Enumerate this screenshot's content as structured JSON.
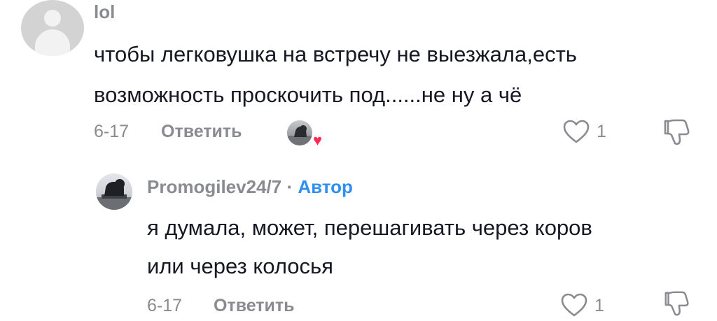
{
  "comments": [
    {
      "username": "lol",
      "text_lines": [
        "чтобы легковушка на встречу не выезжала,есть",
        "возможность проскочить под......не ну а чё"
      ],
      "date": "6-17",
      "reply_label": "Ответить",
      "like_count": "1"
    },
    {
      "username": "Promogilev24/7",
      "separator": "·",
      "author_badge": "Автор",
      "text_lines": [
        "я думала, может, перешагивать через коров",
        "или через колосья"
      ],
      "date": "6-17",
      "reply_label": "Ответить",
      "like_count": "1"
    }
  ],
  "icons": {
    "like": "heart-outline-icon",
    "dislike": "thumbs-down-icon",
    "avatar_default": "default-user-icon",
    "creator_liked": "heart-filled-icon"
  },
  "colors": {
    "text": "#161823",
    "muted": "#8a8b91",
    "author_badge": "#2e8ff0",
    "heart": "#fe2c55"
  }
}
